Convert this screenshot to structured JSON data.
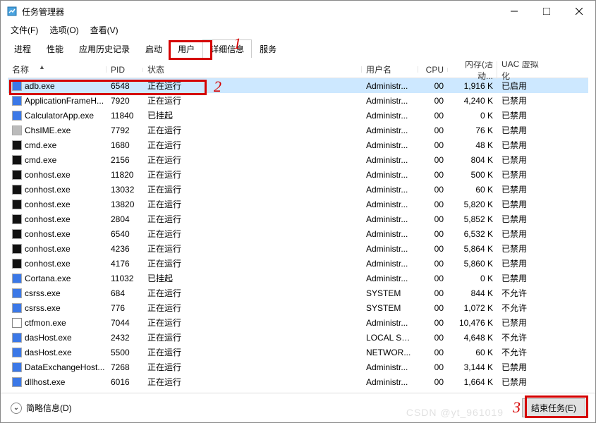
{
  "title": "任务管理器",
  "menubar": [
    "文件(F)",
    "选项(O)",
    "查看(V)"
  ],
  "tabs": [
    "进程",
    "性能",
    "应用历史记录",
    "启动",
    "用户",
    "详细信息",
    "服务"
  ],
  "active_tab_index": 5,
  "columns": {
    "name": "名称",
    "pid": "PID",
    "status": "状态",
    "user": "用户名",
    "cpu": "CPU",
    "memory": "内存(活动...",
    "uac": "UAC 虚拟化"
  },
  "sort_asc_on": "name",
  "footer": {
    "brief": "简略信息(D)",
    "end": "结束任务(E)"
  },
  "annotations": {
    "a1": "1",
    "a2": "2",
    "a3": "3"
  },
  "watermark": "CSDN @yt_961019",
  "rows": [
    {
      "icon": "blue",
      "name": "adb.exe",
      "pid": "6548",
      "status": "正在运行",
      "user": "Administr...",
      "cpu": "00",
      "mem": "1,916 K",
      "uac": "已启用",
      "selected": true
    },
    {
      "icon": "blue",
      "name": "ApplicationFrameH...",
      "pid": "7920",
      "status": "正在运行",
      "user": "Administr...",
      "cpu": "00",
      "mem": "4,240 K",
      "uac": "已禁用"
    },
    {
      "icon": "blue",
      "name": "CalculatorApp.exe",
      "pid": "11840",
      "status": "已挂起",
      "user": "Administr...",
      "cpu": "00",
      "mem": "0 K",
      "uac": "已禁用"
    },
    {
      "icon": "grey",
      "name": "ChsIME.exe",
      "pid": "7792",
      "status": "正在运行",
      "user": "Administr...",
      "cpu": "00",
      "mem": "76 K",
      "uac": "已禁用"
    },
    {
      "icon": "cmd",
      "name": "cmd.exe",
      "pid": "1680",
      "status": "正在运行",
      "user": "Administr...",
      "cpu": "00",
      "mem": "48 K",
      "uac": "已禁用"
    },
    {
      "icon": "cmd",
      "name": "cmd.exe",
      "pid": "2156",
      "status": "正在运行",
      "user": "Administr...",
      "cpu": "00",
      "mem": "804 K",
      "uac": "已禁用"
    },
    {
      "icon": "cmd",
      "name": "conhost.exe",
      "pid": "11820",
      "status": "正在运行",
      "user": "Administr...",
      "cpu": "00",
      "mem": "500 K",
      "uac": "已禁用"
    },
    {
      "icon": "cmd",
      "name": "conhost.exe",
      "pid": "13032",
      "status": "正在运行",
      "user": "Administr...",
      "cpu": "00",
      "mem": "60 K",
      "uac": "已禁用"
    },
    {
      "icon": "cmd",
      "name": "conhost.exe",
      "pid": "13820",
      "status": "正在运行",
      "user": "Administr...",
      "cpu": "00",
      "mem": "5,820 K",
      "uac": "已禁用"
    },
    {
      "icon": "cmd",
      "name": "conhost.exe",
      "pid": "2804",
      "status": "正在运行",
      "user": "Administr...",
      "cpu": "00",
      "mem": "5,852 K",
      "uac": "已禁用"
    },
    {
      "icon": "cmd",
      "name": "conhost.exe",
      "pid": "6540",
      "status": "正在运行",
      "user": "Administr...",
      "cpu": "00",
      "mem": "6,532 K",
      "uac": "已禁用"
    },
    {
      "icon": "cmd",
      "name": "conhost.exe",
      "pid": "4236",
      "status": "正在运行",
      "user": "Administr...",
      "cpu": "00",
      "mem": "5,864 K",
      "uac": "已禁用"
    },
    {
      "icon": "cmd",
      "name": "conhost.exe",
      "pid": "4176",
      "status": "正在运行",
      "user": "Administr...",
      "cpu": "00",
      "mem": "5,860 K",
      "uac": "已禁用"
    },
    {
      "icon": "blue",
      "name": "Cortana.exe",
      "pid": "11032",
      "status": "已挂起",
      "user": "Administr...",
      "cpu": "00",
      "mem": "0 K",
      "uac": "已禁用"
    },
    {
      "icon": "blue",
      "name": "csrss.exe",
      "pid": "684",
      "status": "正在运行",
      "user": "SYSTEM",
      "cpu": "00",
      "mem": "844 K",
      "uac": "不允许"
    },
    {
      "icon": "blue",
      "name": "csrss.exe",
      "pid": "776",
      "status": "正在运行",
      "user": "SYSTEM",
      "cpu": "00",
      "mem": "1,072 K",
      "uac": "不允许"
    },
    {
      "icon": "ed",
      "name": "ctfmon.exe",
      "pid": "7044",
      "status": "正在运行",
      "user": "Administr...",
      "cpu": "00",
      "mem": "10,476 K",
      "uac": "已禁用"
    },
    {
      "icon": "blue",
      "name": "dasHost.exe",
      "pid": "2432",
      "status": "正在运行",
      "user": "LOCAL SE...",
      "cpu": "00",
      "mem": "4,648 K",
      "uac": "不允许"
    },
    {
      "icon": "blue",
      "name": "dasHost.exe",
      "pid": "5500",
      "status": "正在运行",
      "user": "NETWOR...",
      "cpu": "00",
      "mem": "60 K",
      "uac": "不允许"
    },
    {
      "icon": "blue",
      "name": "DataExchangeHost...",
      "pid": "7268",
      "status": "正在运行",
      "user": "Administr...",
      "cpu": "00",
      "mem": "3,144 K",
      "uac": "已禁用"
    },
    {
      "icon": "blue",
      "name": "dllhost.exe",
      "pid": "6016",
      "status": "正在运行",
      "user": "Administr...",
      "cpu": "00",
      "mem": "1,664 K",
      "uac": "已禁用"
    }
  ]
}
